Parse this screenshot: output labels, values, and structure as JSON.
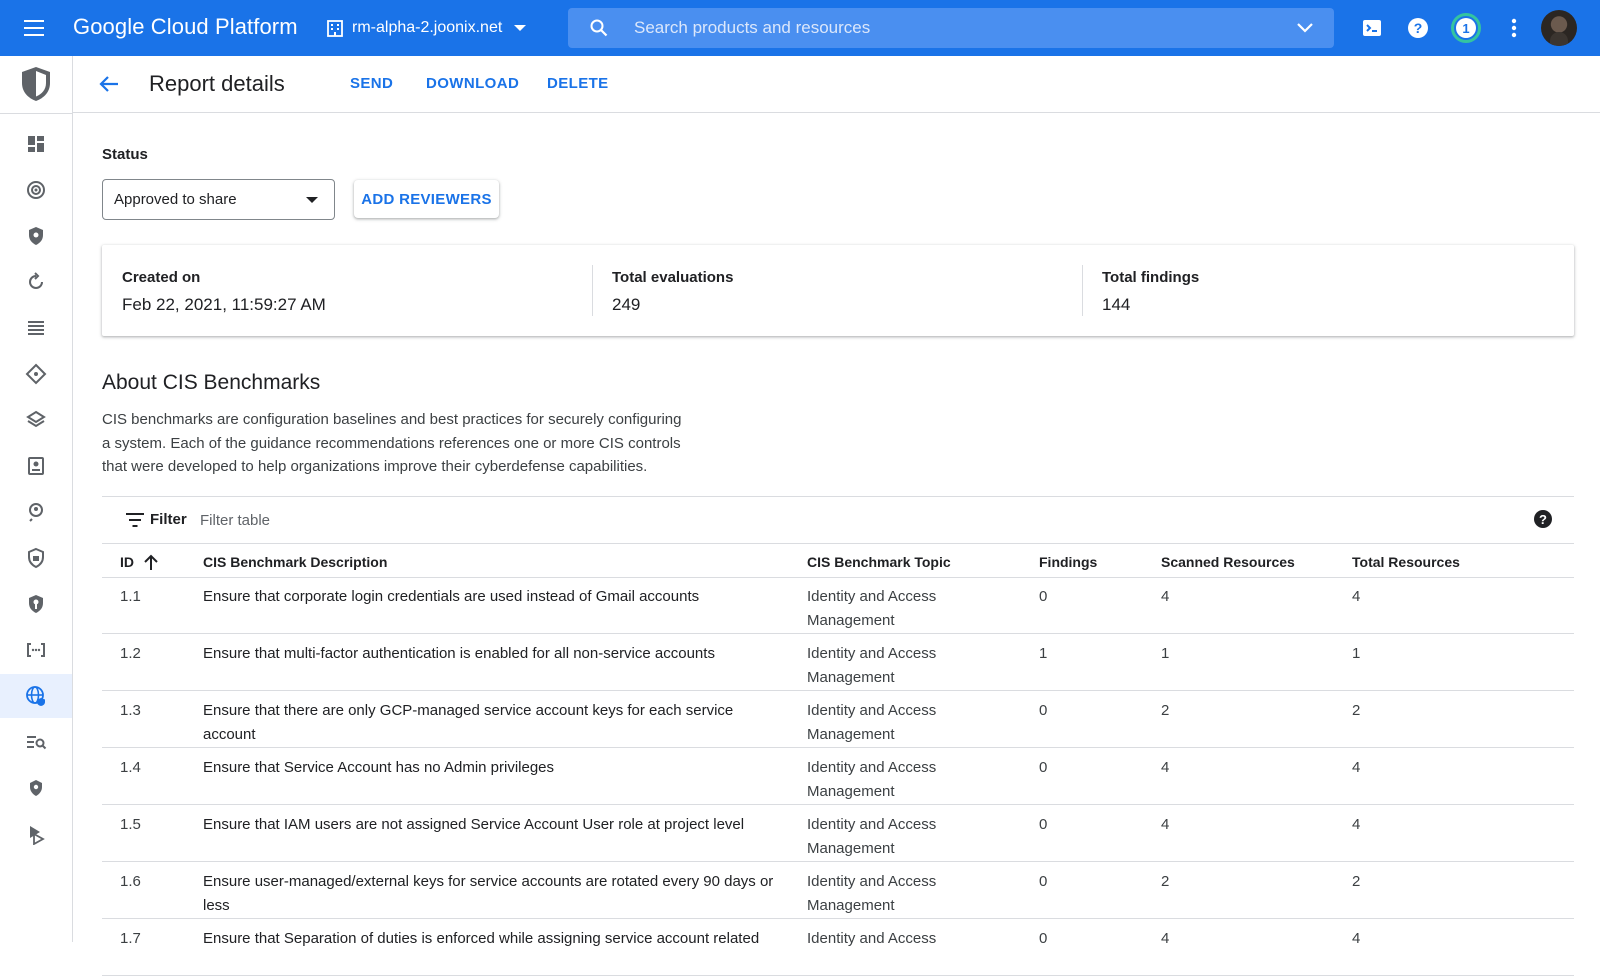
{
  "topbar": {
    "brand": "Google Cloud Platform",
    "project": "rm-alpha-2.joonix.net",
    "search_placeholder": "Search products and resources",
    "notification_count": "1"
  },
  "rail": {
    "items": [
      "dashboard-icon",
      "target-icon",
      "shield-icon",
      "refresh-icon",
      "list-icon",
      "diamond-icon",
      "layers-icon",
      "badge-icon",
      "search-person-icon",
      "shield-lock-icon",
      "shield-key-icon",
      "brackets-icon",
      "globe-shield-icon",
      "list-search-icon",
      "shield-small-icon",
      "flag-icon"
    ],
    "active_index": 12
  },
  "header": {
    "title": "Report details",
    "send": "SEND",
    "download": "DOWNLOAD",
    "delete": "DELETE"
  },
  "status": {
    "label": "Status",
    "value": "Approved to share",
    "add_reviewers": "ADD REVIEWERS"
  },
  "stats": [
    {
      "label": "Created on",
      "value": "Feb 22, 2021, 11:59:27 AM"
    },
    {
      "label": "Total evaluations",
      "value": "249"
    },
    {
      "label": "Total findings",
      "value": "144"
    }
  ],
  "about": {
    "title": "About CIS Benchmarks",
    "lines": [
      "CIS benchmarks are configuration baselines and best practices for securely configuring",
      "a system. Each of the guidance recommendations references one or more CIS controls",
      "that were developed to help organizations improve their cyberdefense capabilities."
    ]
  },
  "filter": {
    "label": "Filter",
    "placeholder": "Filter table"
  },
  "table": {
    "columns": [
      "ID",
      "CIS Benchmark Description",
      "CIS Benchmark Topic",
      "Findings",
      "Scanned Resources",
      "Total Resources"
    ],
    "rows": [
      {
        "id": "1.1",
        "desc": [
          "Ensure that corporate login credentials are used instead of Gmail accounts"
        ],
        "topic": [
          "Identity and Access",
          "Management"
        ],
        "findings": "0",
        "scanned": "4",
        "total": "4"
      },
      {
        "id": "1.2",
        "desc": [
          "Ensure that multi-factor authentication is enabled for all non-service accounts"
        ],
        "topic": [
          "Identity and Access",
          "Management"
        ],
        "findings": "1",
        "scanned": "1",
        "total": "1"
      },
      {
        "id": "1.3",
        "desc": [
          "Ensure that there are only GCP-managed service account keys for each service",
          "account"
        ],
        "topic": [
          "Identity and Access",
          "Management"
        ],
        "findings": "0",
        "scanned": "2",
        "total": "2"
      },
      {
        "id": "1.4",
        "desc": [
          "Ensure that Service Account has no Admin privileges"
        ],
        "topic": [
          "Identity and Access",
          "Management"
        ],
        "findings": "0",
        "scanned": "4",
        "total": "4"
      },
      {
        "id": "1.5",
        "desc": [
          "Ensure that IAM users are not assigned Service Account User role at project level"
        ],
        "topic": [
          "Identity and Access",
          "Management"
        ],
        "findings": "0",
        "scanned": "4",
        "total": "4"
      },
      {
        "id": "1.6",
        "desc": [
          "Ensure user-managed/external keys for service accounts are rotated every 90 days or",
          "less"
        ],
        "topic": [
          "Identity and Access",
          "Management"
        ],
        "findings": "0",
        "scanned": "2",
        "total": "2"
      },
      {
        "id": "1.7",
        "desc": [
          "Ensure that Separation of duties is enforced while assigning service account related"
        ],
        "topic": [
          "Identity and Access"
        ],
        "findings": "0",
        "scanned": "4",
        "total": "4"
      }
    ]
  },
  "colors": {
    "brand_blue": "#1a73e8",
    "rail_active": "#e8f0fe",
    "notif_ring": "#34c4a0"
  }
}
